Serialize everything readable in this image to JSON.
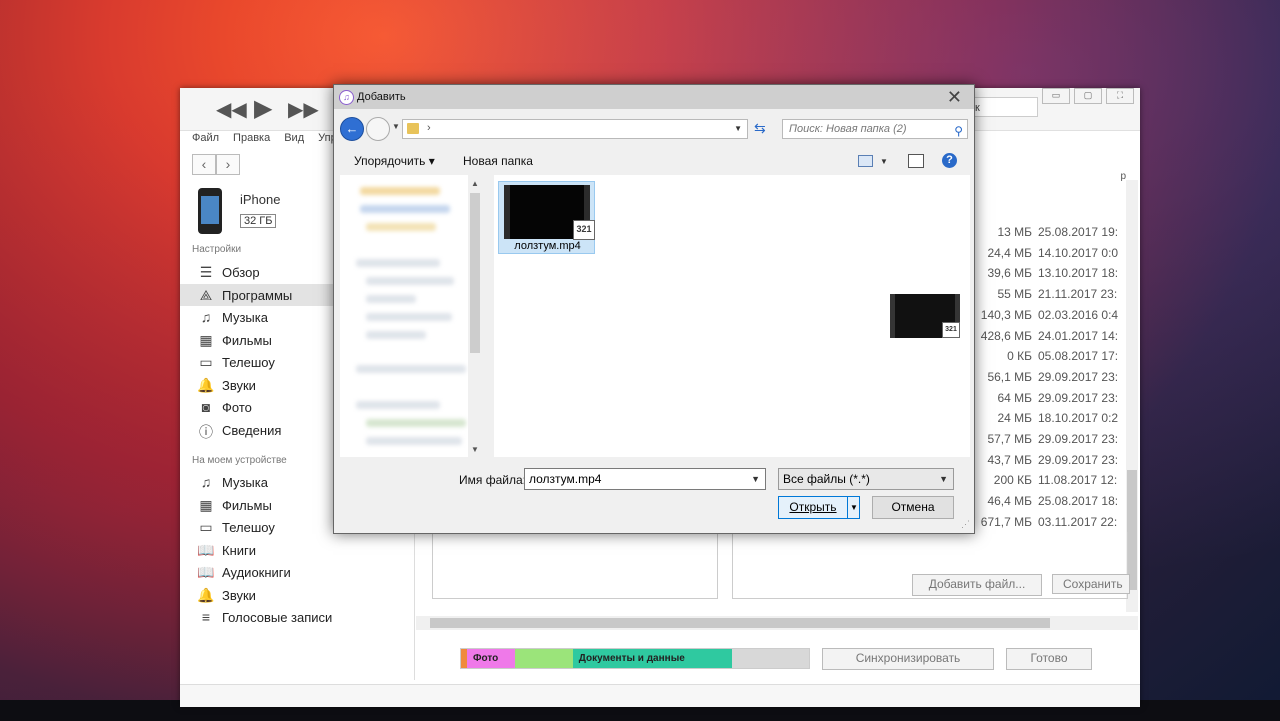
{
  "itunes": {
    "search_text": "к",
    "window_controls": [
      "▭",
      "▢",
      "⛶"
    ],
    "menu": [
      "Файл",
      "Правка",
      "Вид",
      "Упр"
    ],
    "nav": {
      "back": "‹",
      "forward": "›"
    },
    "device": {
      "name": "iPhone",
      "capacity": "32 ГБ"
    },
    "sidebar": {
      "settings_header": "Настройки",
      "settings_items": [
        {
          "label": "Обзор",
          "icon": "summary-icon",
          "glyph": "☰"
        },
        {
          "label": "Программы",
          "icon": "apps-icon",
          "glyph": "⟁"
        },
        {
          "label": "Музыка",
          "icon": "music-icon",
          "glyph": "♫"
        },
        {
          "label": "Фильмы",
          "icon": "film-icon",
          "glyph": "▦"
        },
        {
          "label": "Телешоу",
          "icon": "tv-icon",
          "glyph": "▭"
        },
        {
          "label": "Звуки",
          "icon": "bell-icon",
          "glyph": "🔔"
        },
        {
          "label": "Фото",
          "icon": "camera-icon",
          "glyph": "◙"
        },
        {
          "label": "Сведения",
          "icon": "info-icon",
          "glyph": "ⓘ"
        }
      ],
      "device_header": "На моем устройстве",
      "device_items": [
        {
          "label": "Музыка",
          "icon": "music-icon",
          "glyph": "♫"
        },
        {
          "label": "Фильмы",
          "icon": "film-icon",
          "glyph": "▦"
        },
        {
          "label": "Телешоу",
          "icon": "tv-icon",
          "glyph": "▭"
        },
        {
          "label": "Книги",
          "icon": "book-icon",
          "glyph": "📖"
        },
        {
          "label": "Аудиокниги",
          "icon": "audiobook-icon",
          "glyph": "📖"
        },
        {
          "label": "Звуки",
          "icon": "bell-icon",
          "glyph": "🔔"
        },
        {
          "label": "Голосовые записи",
          "icon": "voice-memo-icon",
          "glyph": "≡"
        }
      ]
    },
    "col_head": "р",
    "files": [
      {
        "size": "13 МБ",
        "date": "25.08.2017 19:"
      },
      {
        "size": "24,4 МБ",
        "date": "14.10.2017 0:0"
      },
      {
        "size": "39,6 МБ",
        "date": "13.10.2017 18:"
      },
      {
        "size": "55 МБ",
        "date": "21.11.2017 23:"
      },
      {
        "size": "140,3 МБ",
        "date": "02.03.2016 0:4"
      },
      {
        "size": "428,6 МБ",
        "date": "24.01.2017 14:"
      },
      {
        "size": "0 КБ",
        "date": "05.08.2017 17:"
      },
      {
        "size": "56,1 МБ",
        "date": "29.09.2017 23:"
      },
      {
        "size": "64 МБ",
        "date": "29.09.2017 23:"
      },
      {
        "size": "24 МБ",
        "date": "18.10.2017 0:2"
      },
      {
        "size": "57,7 МБ",
        "date": "29.09.2017 23:"
      },
      {
        "size": "43,7 МБ",
        "date": "29.09.2017 23:"
      },
      {
        "size": "200 КБ",
        "date": "11.08.2017 12:"
      },
      {
        "size": "46,4 МБ",
        "date": "25.08.2017 18:"
      },
      {
        "size": "671,7 МБ",
        "date": "03.11.2017 22:"
      }
    ],
    "add_file_button": "Добавить файл...",
    "save_button": "Сохранить",
    "capacity_bar": [
      {
        "label": "",
        "color": "#f08a3c",
        "fraction": 0.006
      },
      {
        "label": "Фото",
        "color": "#ef79e9",
        "fraction": 0.137
      },
      {
        "label": "",
        "color": "#9be47a",
        "fraction": 0.167
      },
      {
        "label": "Документы и данные",
        "color": "#2fc9a0",
        "fraction": 0.457
      }
    ],
    "sync_button": "Синхронизировать",
    "done_button": "Готово"
  },
  "dialog": {
    "title": "Добавить",
    "address_separator": "›",
    "search_placeholder": "Поиск: Новая папка (2)",
    "organize": "Упорядочить ▾",
    "new_folder": "Новая папка",
    "help": "?",
    "file_name": "лолзтум.mp4",
    "badge": "321",
    "file_name_label": "Имя файла:",
    "file_name_value": "лолзтум.mp4",
    "file_type": "Все файлы (*.*)",
    "open_button": "Открыть",
    "cancel_button": "Отмена"
  }
}
